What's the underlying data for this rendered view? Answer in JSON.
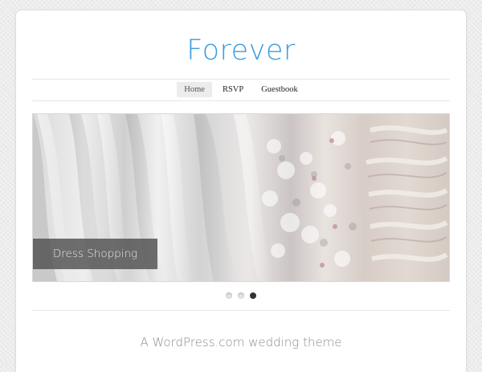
{
  "site": {
    "title": "Forever"
  },
  "nav": {
    "items": [
      {
        "label": "Home"
      },
      {
        "label": "RSVP"
      },
      {
        "label": "Guestbook"
      }
    ],
    "active_index": 0
  },
  "slider": {
    "caption": "Dress Shopping",
    "slide_count": 3,
    "active_slide": 3,
    "image_subject": "wedding dresses"
  },
  "footer": {
    "tagline": "A WordPress.com wedding theme"
  },
  "colors": {
    "title": "#3b9be0",
    "tagline": "#8c8c8c",
    "background": "#ececec",
    "active_dot": "#333333"
  }
}
